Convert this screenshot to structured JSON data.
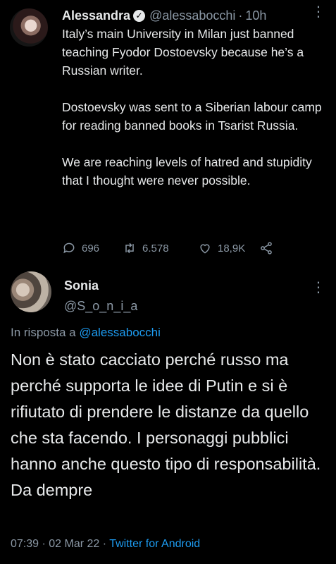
{
  "original_tweet": {
    "display_name": "Alessandra",
    "handle": "@alessabocchi",
    "separator": "·",
    "time": "10h",
    "paragraphs": [
      "Italy’s main University in Milan just banned teaching Fyodor Dostoevsky because he’s a Russian writer.",
      "Dostoevsky was sent to a Siberian labour camp for reading banned books in Tsarist Russia.",
      "We are reaching levels of hatred and stupidity that I thought were never possible."
    ],
    "actions": {
      "replies": "696",
      "retweets": "6.578",
      "likes": "18,9K"
    }
  },
  "reply_tweet": {
    "display_name": "Sonia",
    "handle": "@S_o_n_i_a",
    "reply_prefix": "In risposta a",
    "reply_to_handle": "@alessabocchi",
    "text": "Non è stato cacciato perché russo ma perché supporta le idee di Putin e si è rifiutato di prendere le distanze da quello che sta facendo. I personaggi pubblici hanno anche questo tipo di responsabilità. Da dempre",
    "timestamp": "07:39 · 02 Mar 22 ·",
    "source": "Twitter for Android"
  },
  "colors": {
    "background": "#000000",
    "text": "#e7e9ea",
    "secondary": "#8b98a5",
    "link": "#1d9bf0"
  },
  "icons": [
    "verified-badge-icon",
    "more-options-icon",
    "reply-icon",
    "retweet-icon",
    "like-icon",
    "share-icon"
  ]
}
